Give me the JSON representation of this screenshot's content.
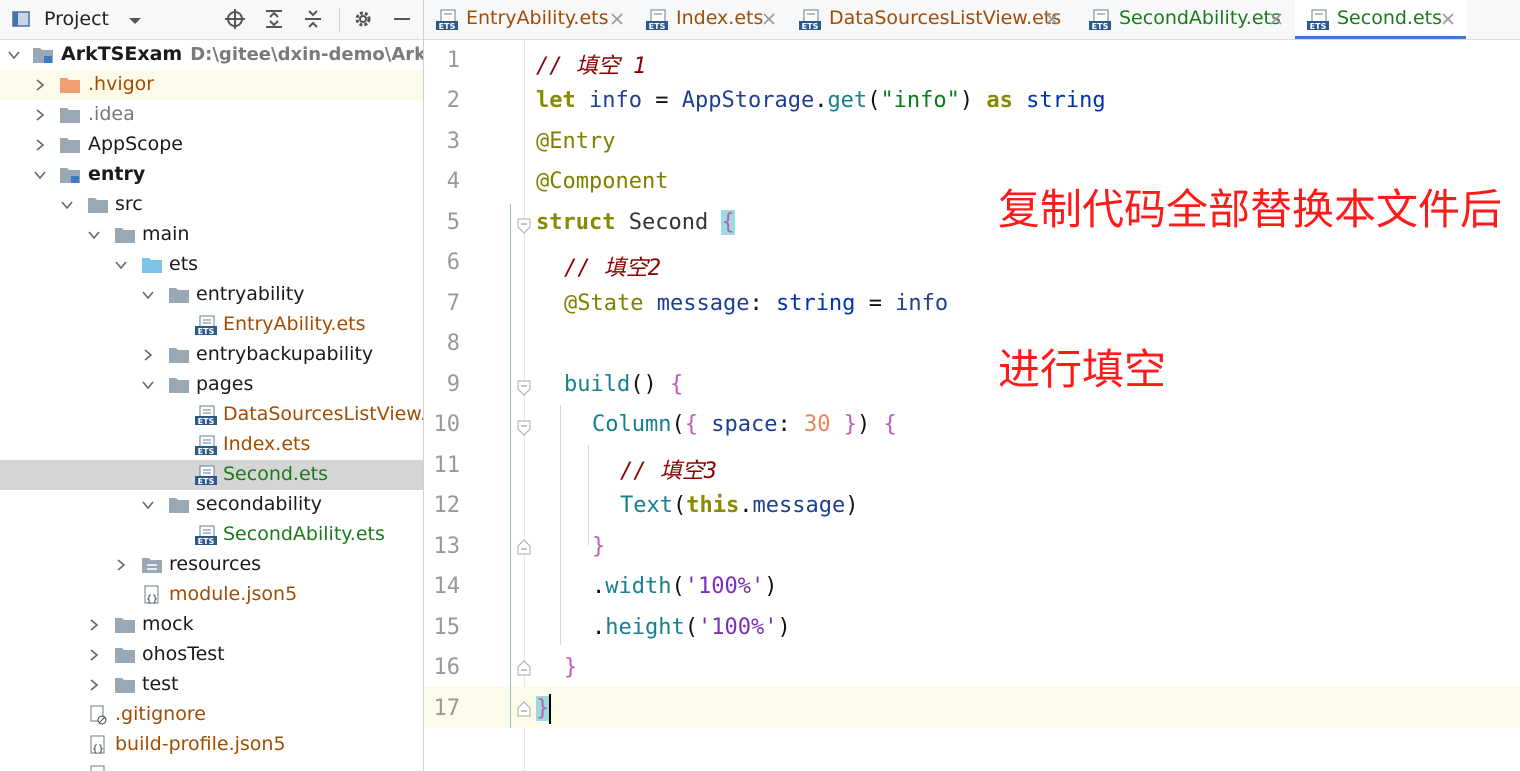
{
  "project_panel": {
    "title": "Project",
    "tree": [
      {
        "label": "ArkTSExam",
        "path": "D:\\gitee\\dxin-demo\\ArkTSEx"
      },
      {
        "label": ".hvigor"
      },
      {
        "label": ".idea"
      },
      {
        "label": "AppScope"
      },
      {
        "label": "entry"
      },
      {
        "label": "src"
      },
      {
        "label": "main"
      },
      {
        "label": "ets"
      },
      {
        "label": "entryability"
      },
      {
        "label": "EntryAbility.ets"
      },
      {
        "label": "entrybackupability"
      },
      {
        "label": "pages"
      },
      {
        "label": "DataSourcesListView.et"
      },
      {
        "label": "Index.ets"
      },
      {
        "label": "Second.ets"
      },
      {
        "label": "secondability"
      },
      {
        "label": "SecondAbility.ets"
      },
      {
        "label": "resources"
      },
      {
        "label": "module.json5"
      },
      {
        "label": "mock"
      },
      {
        "label": "ohosTest"
      },
      {
        "label": "test"
      },
      {
        "label": ".gitignore"
      },
      {
        "label": "build-profile.json5"
      }
    ]
  },
  "tabs": [
    {
      "label": "EntryAbility.ets"
    },
    {
      "label": "Index.ets"
    },
    {
      "label": "DataSourcesListView.ets"
    },
    {
      "label": "SecondAbility.ets"
    },
    {
      "label": "Second.ets"
    }
  ],
  "editor": {
    "line_numbers": [
      "1",
      "2",
      "3",
      "4",
      "5",
      "6",
      "7",
      "8",
      "9",
      "10",
      "11",
      "12",
      "13",
      "14",
      "15",
      "16",
      "17"
    ],
    "lines": {
      "l1": {
        "comment": "// 填空 1"
      },
      "l2": {
        "kw": "let",
        "var": "info",
        "eq": "=",
        "obj": "AppStorage",
        "dot": ".",
        "method": "get",
        "p1": "(",
        "str": "\"info\"",
        "p2": ")",
        "as": "as",
        "type": "string"
      },
      "l3": {
        "anno": "@Entry"
      },
      "l4": {
        "anno": "@Component"
      },
      "l5": {
        "kw": "struct",
        "name": "Second",
        "brace": "{"
      },
      "l6": {
        "comment": "// 填空2"
      },
      "l7": {
        "anno": "@State",
        "prop": "message",
        "colon": ":",
        "type": "string",
        "eq": "=",
        "val": "info"
      },
      "l9": {
        "fn": "build",
        "parens": "()",
        "brace": "{"
      },
      "l10": {
        "fn": "Column",
        "p1": "(",
        "b1": "{",
        "key": "space",
        "colon": ":",
        "num": "30",
        "b2": "}",
        "p2": ")",
        "brace": "{"
      },
      "l11": {
        "comment": "// 填空3"
      },
      "l12": {
        "fn": "Text",
        "p1": "(",
        "this": "this",
        "dot": ".",
        "prop": "message",
        "p2": ")"
      },
      "l13": {
        "brace": "}"
      },
      "l14": {
        "dot": ".",
        "method": "width",
        "p1": "(",
        "str": "'100%'",
        "p2": ")"
      },
      "l15": {
        "dot": ".",
        "method": "height",
        "p1": "(",
        "str": "'100%'",
        "p2": ")"
      },
      "l16": {
        "brace": "}"
      },
      "l17": {
        "brace": "}"
      }
    }
  },
  "annotations": {
    "instruction_line1": "复制代码全部替换本文件后",
    "instruction_line2": "进行填空"
  },
  "colors": {
    "annotation": "#ff1a1a",
    "active_tab_underline": "#3a7ad6",
    "selection": "#d5d5d5",
    "current_line": "#fcfae8"
  }
}
